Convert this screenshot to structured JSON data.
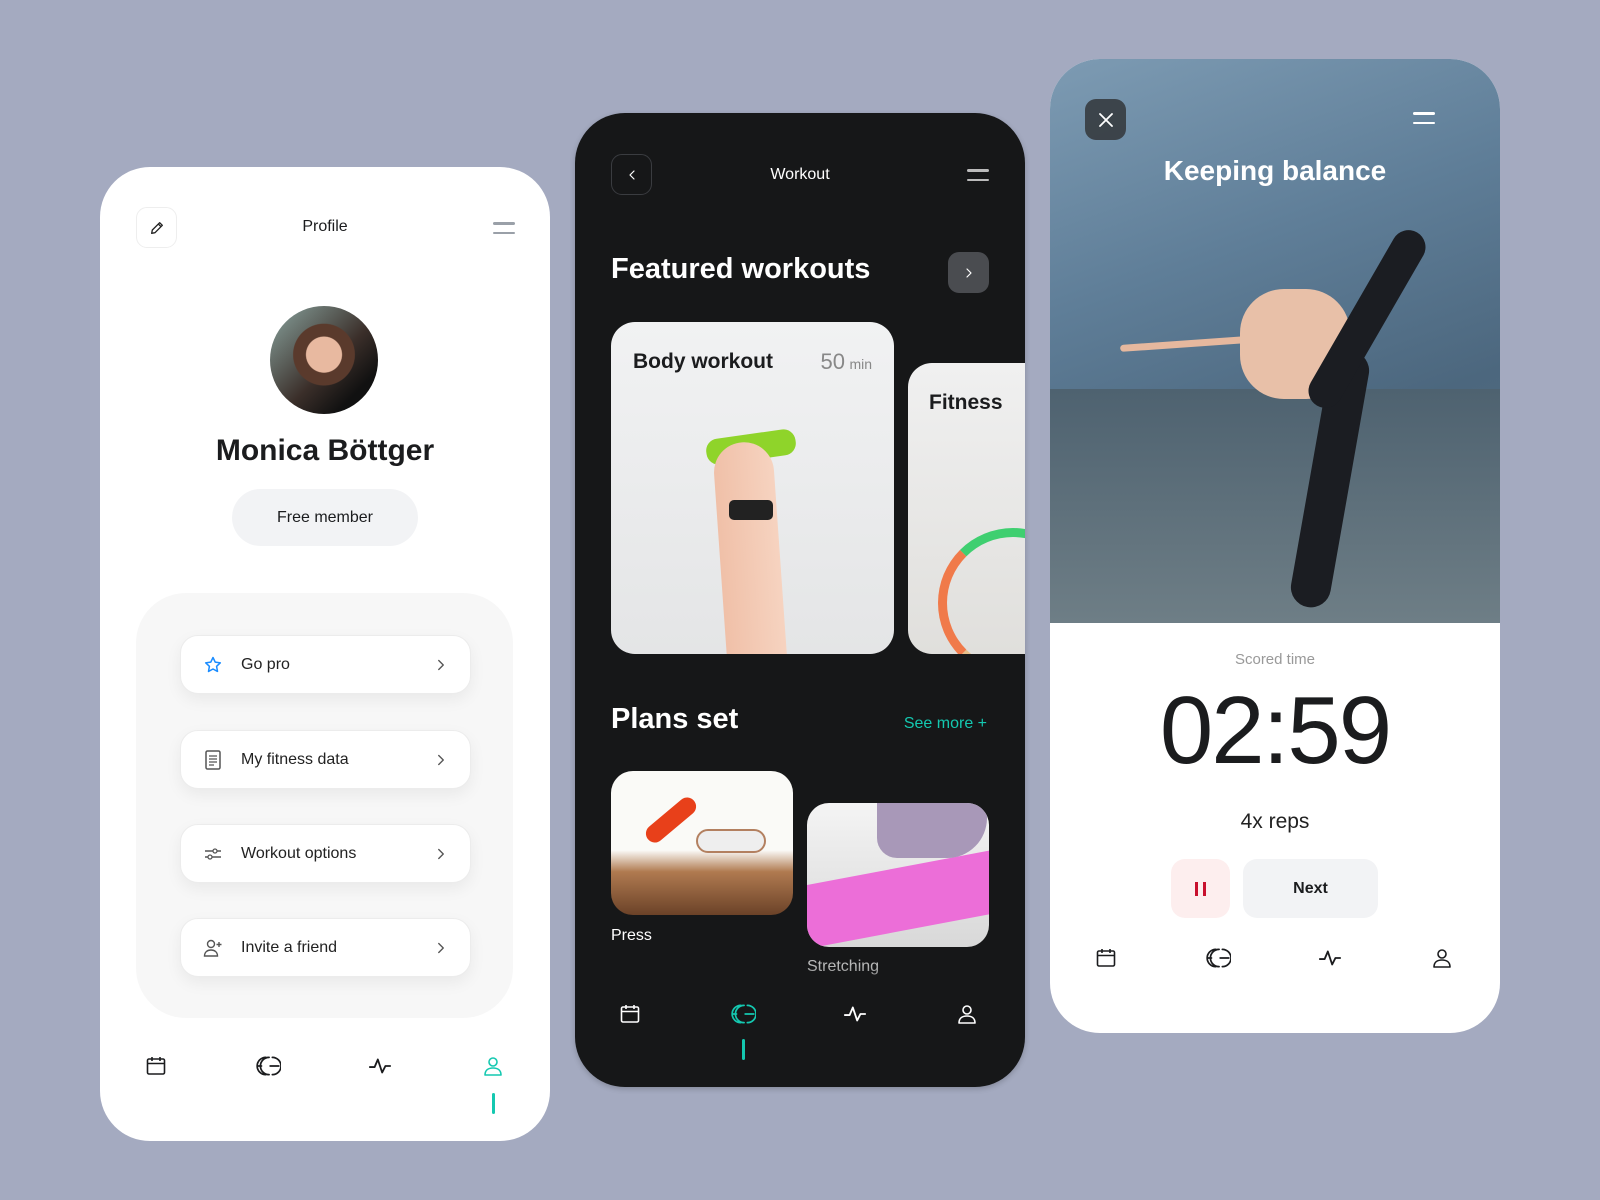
{
  "colors": {
    "background": "#a4aac0",
    "accent": "#14c8b0",
    "pause": "#c8102e",
    "pause_bg": "#fdeeee",
    "dark_panel": "#161718"
  },
  "profile": {
    "title": "Profile",
    "edit_icon": "pencil-icon",
    "menu_icon": "hamburger-icon",
    "name": "Monica Böttger",
    "membership": "Free member",
    "items": [
      {
        "label": "Go pro",
        "icon": "star-icon"
      },
      {
        "label": "My fitness data",
        "icon": "document-icon"
      },
      {
        "label": "Workout options",
        "icon": "sliders-icon"
      },
      {
        "label": "Invite a friend",
        "icon": "add-user-icon"
      }
    ],
    "active_nav": "profile"
  },
  "workout": {
    "title": "Workout",
    "featured_title": "Featured workouts",
    "featured": [
      {
        "title": "Body workout",
        "duration": "50",
        "unit": "min"
      },
      {
        "title": "Fitness"
      }
    ],
    "plans_title": "Plans set",
    "see_more": "See more +",
    "plans": [
      {
        "label": "Press"
      },
      {
        "label": "Stretching"
      }
    ],
    "active_nav": "workout"
  },
  "exercise": {
    "title": "Keeping balance",
    "scored_label": "Scored time",
    "time": "02:59",
    "reps": "4x reps",
    "next_label": "Next",
    "pause_icon": "pause-icon",
    "close_icon": "close-icon"
  },
  "nav_items": [
    "calendar-icon",
    "workout-icon",
    "activity-icon",
    "profile-icon"
  ]
}
